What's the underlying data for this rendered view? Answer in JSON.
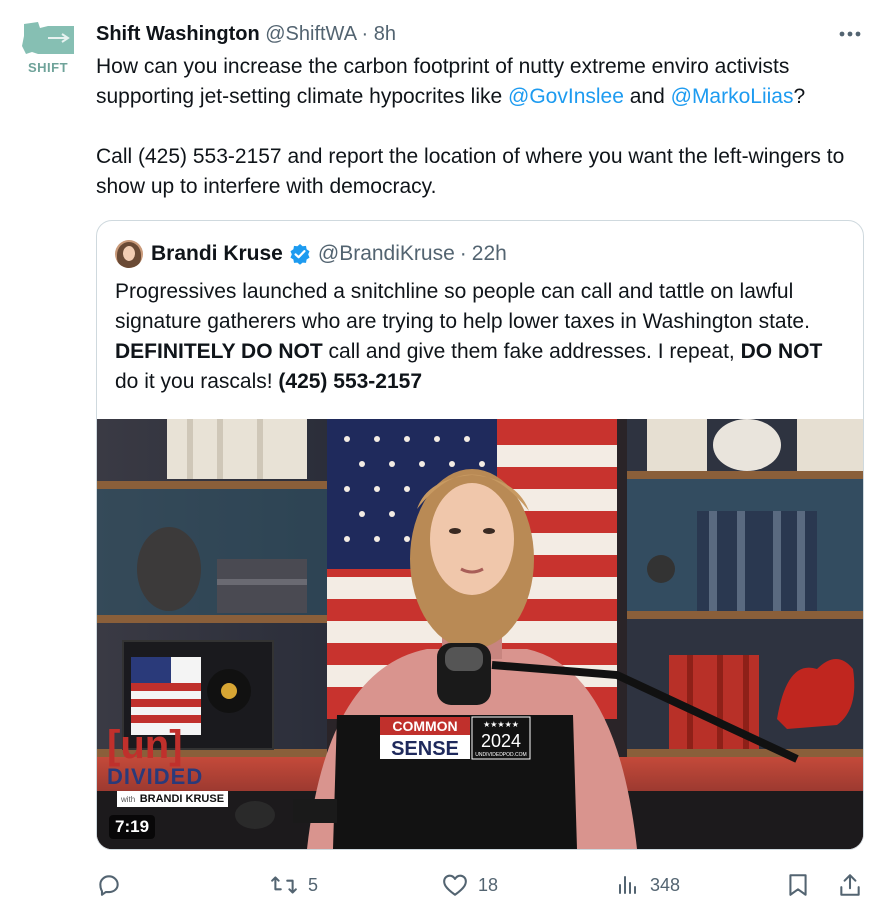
{
  "tweet": {
    "avatar_label": "SHIFT",
    "author_name": "Shift Washington",
    "author_handle": "@ShiftWA",
    "separator": "·",
    "time": "8h",
    "text_p1_a": "How can you increase the carbon footprint of nutty extreme enviro activists supporting jet-setting climate hypocrites like ",
    "mention_1": "@GovInslee",
    "text_p1_b": " and ",
    "mention_2": "@MarkoLiias",
    "text_p1_c": "?",
    "text_p2": "Call (425) 553-2157 and report the location of where you want the left-wingers to show up to interfere with democracy."
  },
  "quote": {
    "author_name": "Brandi Kruse",
    "author_handle": "@BrandiKruse",
    "separator": "·",
    "time": "22h",
    "t1": "Progressives launched a snitchline so people can call and tattle on lawful signature gatherers who are trying to help lower taxes in Washington state. ",
    "t2": "DEFINITELY DO NOT",
    "t3": " call and give them fake addresses. I repeat, ",
    "t4": "DO NOT",
    "t5": " do it you rascals! ",
    "t6": "(425) 553-2157",
    "video": {
      "duration": "7:19",
      "logo_top": "[un]",
      "logo_mid": "DIVIDED",
      "logo_with": "with",
      "logo_name": "BRANDI KRUSE",
      "sticker_line1": "COMMON",
      "sticker_line2": "SENSE",
      "sticker_year": "2024",
      "sticker_url": "UNDIVIDEDPOD.COM"
    }
  },
  "actions": {
    "reply_count": "",
    "retweet_count": "5",
    "like_count": "18",
    "views_count": "348"
  },
  "colors": {
    "link": "#1d9bf0",
    "muted": "#536471",
    "verified": "#1d9bf0",
    "border": "#cfd9de"
  }
}
